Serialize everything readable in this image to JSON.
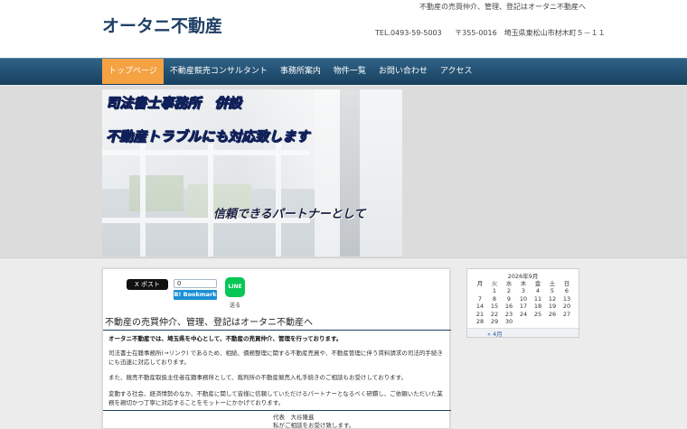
{
  "header": {
    "tagline": "不動産の売買仲介、管理、登記はオータニ不動産へ",
    "site_title": "オータニ不動産",
    "tel": "TEL.0493-59-5003",
    "address": "〒355-0016　埼玉県東松山市材木町５－１１"
  },
  "nav": {
    "items": [
      {
        "label": "トップページ"
      },
      {
        "label": "不動産競売コンサルタント"
      },
      {
        "label": "事務所案内"
      },
      {
        "label": "物件一覧"
      },
      {
        "label": "お問い合わせ"
      },
      {
        "label": "アクセス"
      }
    ]
  },
  "hero": {
    "line1": "司法書士事務所　併設",
    "line2": "不動産トラブルにも対応致します",
    "line3": "信頼できるパートナーとして"
  },
  "share": {
    "x_label": "X ポスト",
    "bookmark_count": "0",
    "bookmark_label": "B! Bookmark",
    "line_label": "LINE",
    "line_caption": "送る"
  },
  "content": {
    "heading": "不動産の売買仲介、管理、登記はオータニ不動産へ",
    "p1": "オータニ不動産では、埼玉県を中心として、不動産の売買仲介、管理を行っております。",
    "p2": "司法書士在籍事務所(→リンク) であるため、相続、債務整理に関する不動産売買や、不動産管理に伴う賃料請求の司法的手続きにも迅速に対応しております。",
    "p3": "また、競売不動産取扱主任者在籍事務所として、裁判所の不動産競売入札手続きのご相談もお受けしております。",
    "p4": "変動する社会、経済情勢のなか、不動産に関して皆様に信頼していただけるパートナーとなるべく研鑽し、ご依頼いただいた業務を親切かつ丁寧に対応することをモットーにかかげております。",
    "sig_line1": "代表　大谷隆進",
    "sig_line2": "私がご相談をお受け致します。"
  },
  "calendar": {
    "title": "2026年9月",
    "weekdays": [
      "月",
      "火",
      "水",
      "木",
      "金",
      "土",
      "日"
    ],
    "weeks": [
      [
        "",
        "1",
        "2",
        "3",
        "4",
        "5",
        "6"
      ],
      [
        "7",
        "8",
        "9",
        "10",
        "11",
        "12",
        "13"
      ],
      [
        "14",
        "15",
        "16",
        "17",
        "18",
        "19",
        "20"
      ],
      [
        "21",
        "22",
        "23",
        "24",
        "25",
        "26",
        "27"
      ],
      [
        "28",
        "29",
        "30",
        "",
        "",
        "",
        ""
      ]
    ],
    "prev_link": "« 4月"
  }
}
